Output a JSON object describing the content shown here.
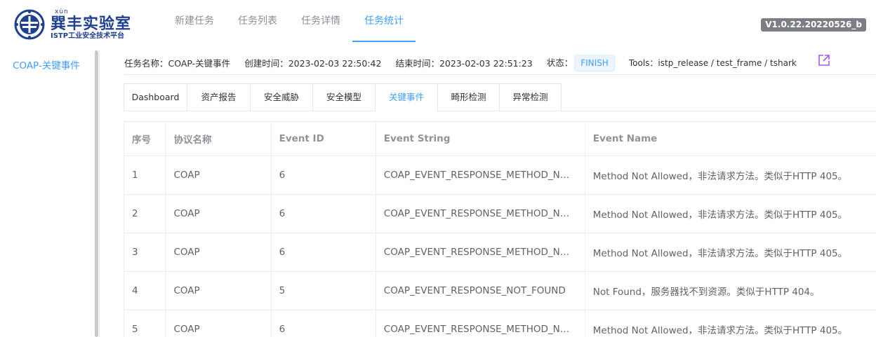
{
  "logo": {
    "pinyin": "xùn",
    "title": "巽丰实验室",
    "subtitle": "ISTP工业安全技术平台"
  },
  "topnav": [
    {
      "label": "新建任务",
      "active": false
    },
    {
      "label": "任务列表",
      "active": false
    },
    {
      "label": "任务详情",
      "active": false
    },
    {
      "label": "任务统计",
      "active": true
    }
  ],
  "version": "V1.0.22.20220526_b",
  "sidebar": {
    "items": [
      {
        "label": "COAP-关键事件",
        "active": true
      }
    ]
  },
  "info": {
    "task_name": "任务名称：COAP-关键事件",
    "created": "创建时间：2023-02-03 22:50:42",
    "ended": "结束时间：2023-02-03 22:51:23",
    "status_label": "状态：",
    "status_value": "FINISH",
    "tools": "Tools：istp_release / test_frame / tshark"
  },
  "tabs": [
    {
      "label": "Dashboard",
      "width": 90,
      "active": false
    },
    {
      "label": "资产报告",
      "width": 90,
      "active": false
    },
    {
      "label": "安全威胁",
      "width": 89,
      "active": false
    },
    {
      "label": "安全模型",
      "width": 89,
      "active": false
    },
    {
      "label": "关键事件",
      "width": 89,
      "active": true
    },
    {
      "label": "畸形检测",
      "width": 88,
      "active": false
    },
    {
      "label": "异常检测",
      "width": 89,
      "active": false
    }
  ],
  "table": {
    "columns": [
      "序号",
      "协议名称",
      "Event ID",
      "Event String",
      "Event Name"
    ],
    "rows": [
      [
        "1",
        "COAP",
        "6",
        "COAP_EVENT_RESPONSE_METHOD_N…",
        "Method Not Allowed，非法请求方法。类似于HTTP 405。"
      ],
      [
        "2",
        "COAP",
        "6",
        "COAP_EVENT_RESPONSE_METHOD_N…",
        "Method Not Allowed，非法请求方法。类似于HTTP 405。"
      ],
      [
        "3",
        "COAP",
        "6",
        "COAP_EVENT_RESPONSE_METHOD_N…",
        "Method Not Allowed，非法请求方法。类似于HTTP 405。"
      ],
      [
        "4",
        "COAP",
        "5",
        "COAP_EVENT_RESPONSE_NOT_FOUND",
        "Not Found，服务器找不到资源。类似于HTTP 404。"
      ],
      [
        "5",
        "COAP",
        "6",
        "COAP_EVENT_RESPONSE_METHOD_N…",
        "Method Not Allowed，非法请求方法。类似于HTTP 405。"
      ]
    ]
  },
  "colors": {
    "accent": "#409eff",
    "brand": "#1f3f8f",
    "version_bg": "#7b7f85",
    "external_icon": "#a855f7"
  },
  "icons": {
    "external_link": "external-link-icon",
    "logo": "logo-icon"
  }
}
